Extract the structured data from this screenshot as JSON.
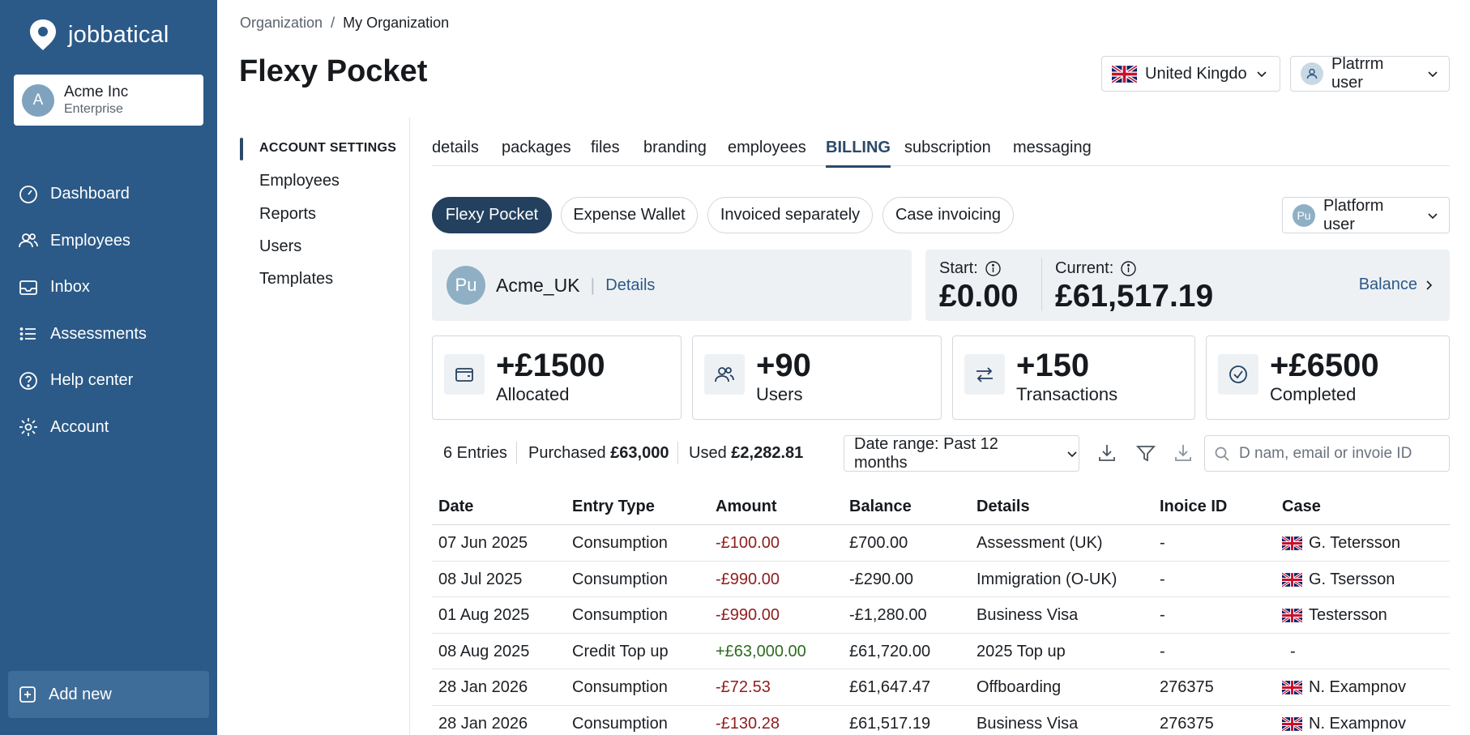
{
  "sidebar": {
    "brand": "jobbatical",
    "org": {
      "avatar": "A",
      "name": "Acme Inc",
      "plan": "Enterprise"
    },
    "items": [
      {
        "label": "Dashboard",
        "icon": "dashboard-icon"
      },
      {
        "label": "Employees",
        "icon": "users-icon"
      },
      {
        "label": "Inbox",
        "icon": "inbox-icon"
      },
      {
        "label": "Assessments",
        "icon": "list-icon"
      },
      {
        "label": "Help center",
        "icon": "help-icon"
      },
      {
        "label": "Account",
        "icon": "gear-icon"
      }
    ],
    "add_new": "Add new"
  },
  "breadcrumb": {
    "root": "Organization",
    "separator": "/",
    "current": "My Organization"
  },
  "page_title": "Flexy Pocket",
  "header": {
    "country": "United Kingdoı",
    "user": "Platrrm user"
  },
  "settings_menu": {
    "heading": "ACCOUNT SETTINGS",
    "items": [
      "Employees",
      "Reports",
      "Users",
      "Templates"
    ]
  },
  "tabs": [
    "details",
    "packages",
    "files",
    "branding",
    "employees",
    "BILLING",
    "subscription",
    "messaging"
  ],
  "active_tab": "BILLING",
  "pills": [
    "Flexy Pocket",
    "Expense Wallet",
    "Invoiced separately",
    "Case invoicing"
  ],
  "active_pill": "Flexy Pocket",
  "user_select": {
    "avatar": "Pu",
    "label": "Platform user"
  },
  "account": {
    "avatar": "Pu",
    "name": "Acme_UK",
    "separator": "|",
    "details_link": "Details"
  },
  "balance": {
    "start_label": "Start:",
    "start_value": "£0.00",
    "current_label": "Current:",
    "current_value": "£61,517.19",
    "link": "Balance"
  },
  "stats": [
    {
      "value": "+£1500",
      "label": "Allocated",
      "icon": "wallet-icon"
    },
    {
      "value": "+90",
      "label": "Users",
      "icon": "users-icon"
    },
    {
      "value": "+150",
      "label": "Transactions",
      "icon": "transfer-icon"
    },
    {
      "value": "+£6500",
      "label": "Completed",
      "icon": "check-circle-icon"
    }
  ],
  "filter_bar": {
    "entries": "6 Entries",
    "purchased_label": "Purchased",
    "purchased_value": "£63,000",
    "used_label": "Used",
    "used_value": "£2,282.81",
    "date_range": "Date range: Past 12 months",
    "search_placeholder": "D nam, email or invoie ID"
  },
  "table": {
    "columns": [
      "Date",
      "Entry Type",
      "Amount",
      "Balance",
      "Details",
      "Inoice ID",
      "Case"
    ],
    "rows": [
      {
        "date": "07 Jun 2025",
        "type": "Consumption",
        "amount": "-£100.00",
        "sign": "neg",
        "balance": "£700.00",
        "details": "Assessment (UK)",
        "invoice": "-",
        "case": "G. Tetersson",
        "flag": true
      },
      {
        "date": "08 Jul 2025",
        "type": "Consumption",
        "amount": "-£990.00",
        "sign": "neg",
        "balance": "-£290.00",
        "details": "Immigration (O-UK)",
        "invoice": "-",
        "case": "G. Tsersson",
        "flag": true
      },
      {
        "date": "01 Aug 2025",
        "type": "Consumption",
        "amount": "-£990.00",
        "sign": "neg",
        "balance": "-£1,280.00",
        "details": "Business Visa",
        "invoice": "-",
        "case": "Testersson",
        "flag": true
      },
      {
        "date": "08 Aug 2025",
        "type": "Credit Top up",
        "amount": "+£63,000.00",
        "sign": "pos",
        "balance": "£61,720.00",
        "details": "2025 Top up",
        "invoice": "-",
        "case": "-",
        "flag": false
      },
      {
        "date": "28 Jan 2026",
        "type": "Consumption",
        "amount": "-£72.53",
        "sign": "neg",
        "balance": "£61,647.47",
        "details": "Offboarding",
        "invoice": "276375",
        "case": "N. Exampnov",
        "flag": true
      },
      {
        "date": "28 Jan 2026",
        "type": "Consumption",
        "amount": "-£130.28",
        "sign": "neg",
        "balance": "£61,517.19",
        "details": "Business Visa",
        "invoice": "276375",
        "case": "N. Exampnov",
        "flag": true
      }
    ]
  },
  "colors": {
    "sidebar": "#2b5a88",
    "active_pill": "#24405f",
    "negative": "#8f1d1d",
    "positive": "#2e6b1f",
    "link": "#2b5a88"
  }
}
